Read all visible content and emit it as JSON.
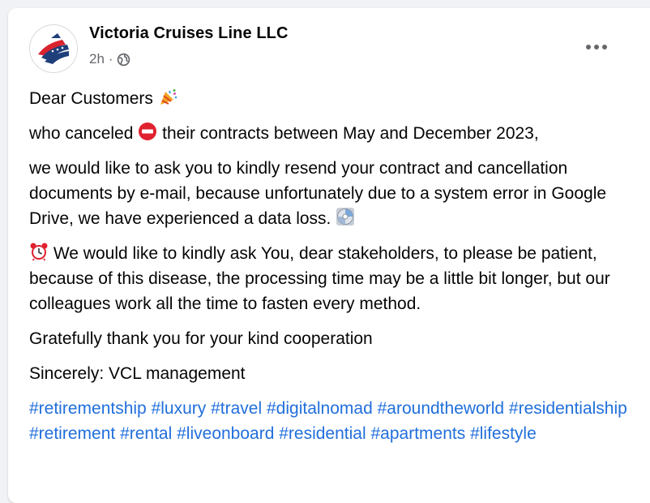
{
  "post": {
    "author": "Victoria Cruises Line LLC",
    "time": "2h",
    "separator": "·",
    "privacy_icon": "globe-icon",
    "more_icon": "more-options-icon",
    "paragraphs": {
      "greeting": "Dear Customers",
      "canceled_before": "who canceled",
      "canceled_after": "their contracts between May and December 2023,",
      "resend": "we would like to ask you to kindly resend your contract and cancellation documents by e-mail, because unfortunately due to a system error in Google Drive, we have experienced a data loss.",
      "patience": "We would like to kindly ask You, dear stakeholders, to please be patient, because of this disease, the processing time may be a little bit longer, but our colleagues work all the time to fasten every method.",
      "thanks": "Gratefully thank you for your kind cooperation",
      "signoff": "Sincerely: VCL management"
    },
    "emoji_icons": [
      "party-popper-icon",
      "no-entry-icon",
      "cd-disc-icon",
      "alarm-clock-icon"
    ],
    "hashtags": [
      "#retirementship",
      "#luxury",
      "#travel",
      "#digitalnomad",
      "#aroundtheworld",
      "#residentialship",
      "#retirement",
      "#rental",
      "#liveonboard",
      "#residential",
      "#apartments",
      "#lifestyle"
    ]
  },
  "colors": {
    "link": "#216fdb",
    "secondary_text": "#65676b",
    "primary_text": "#050505",
    "logo_red": "#d9232e",
    "logo_navy": "#1f3f7a"
  }
}
